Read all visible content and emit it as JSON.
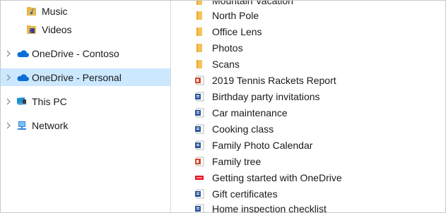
{
  "nav": {
    "music": "Music",
    "videos": "Videos",
    "onedrive_contoso": "OneDrive - Contoso",
    "onedrive_personal": "OneDrive - Personal",
    "this_pc": "This PC",
    "network": "Network"
  },
  "files": [
    {
      "name": "Mountain Vacation",
      "kind": "folder"
    },
    {
      "name": "North Pole",
      "kind": "folder"
    },
    {
      "name": "Office Lens",
      "kind": "folder"
    },
    {
      "name": "Photos",
      "kind": "folder"
    },
    {
      "name": "Scans",
      "kind": "folder"
    },
    {
      "name": "2019 Tennis Rackets Report",
      "kind": "pptx"
    },
    {
      "name": "Birthday party invitations",
      "kind": "docx"
    },
    {
      "name": "Car maintenance",
      "kind": "docx"
    },
    {
      "name": "Cooking class",
      "kind": "docx"
    },
    {
      "name": "Family Photo Calendar",
      "kind": "docx"
    },
    {
      "name": "Family tree",
      "kind": "pptx"
    },
    {
      "name": "Getting started with OneDrive",
      "kind": "pdf"
    },
    {
      "name": "Gift certificates",
      "kind": "docx"
    },
    {
      "name": "Home inspection checklist",
      "kind": "docx"
    }
  ],
  "colors": {
    "selected_bg": "#cce8ff",
    "folder": "#f4c35a",
    "onedrive_blue": "#0a6fd6",
    "word_blue": "#2b579a",
    "ppt_red": "#d24726",
    "pdf_red": "#e81123"
  }
}
